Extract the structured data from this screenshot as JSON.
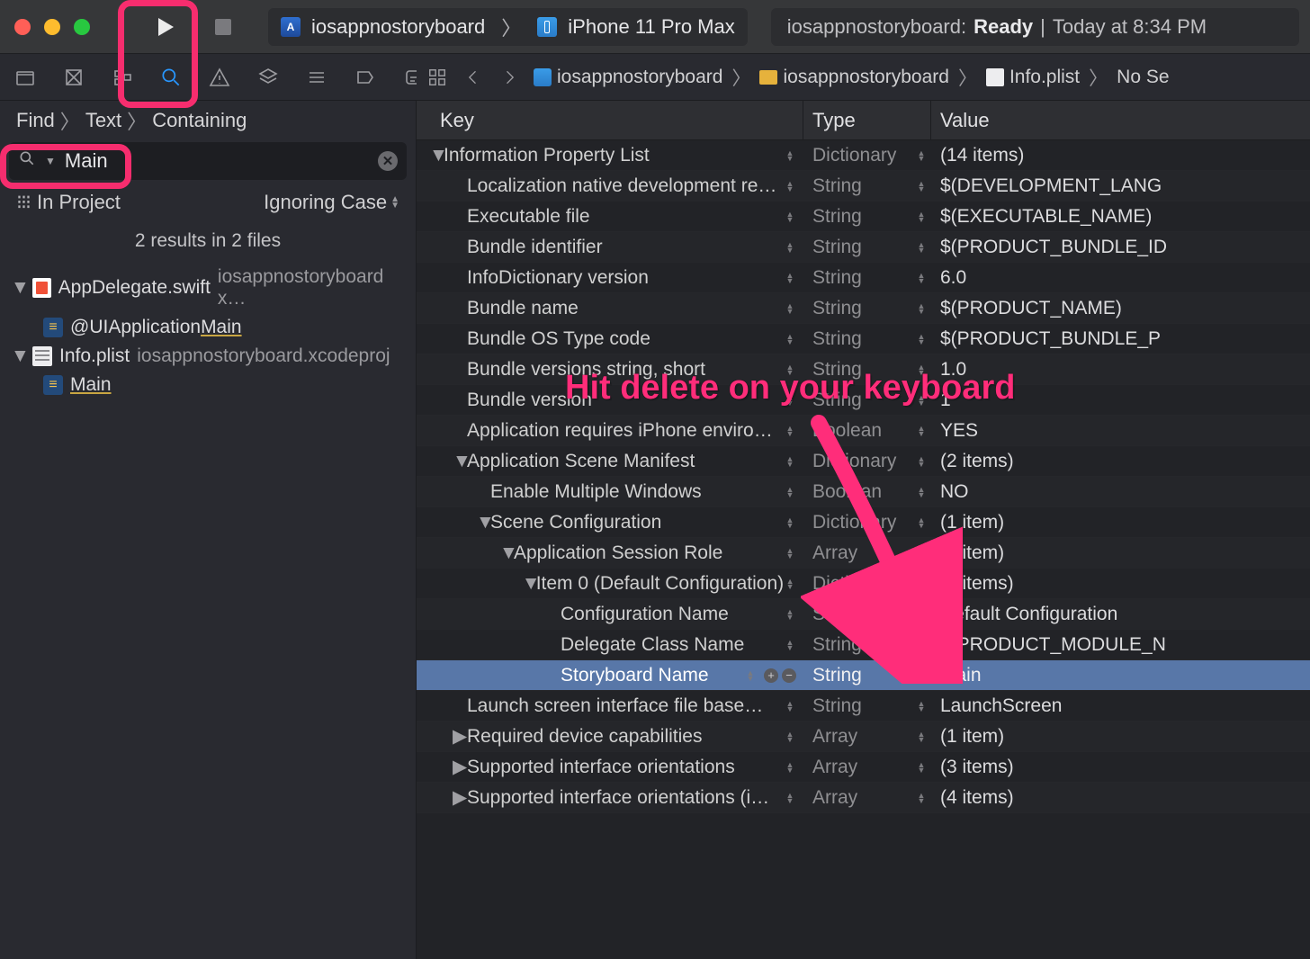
{
  "toolbar": {
    "scheme_app": "iosappnostoryboard",
    "scheme_device": "iPhone 11 Pro Max",
    "status_app": "iosappnostoryboard:",
    "status_state": "Ready",
    "status_sep": "|",
    "status_time": "Today at 8:34 PM"
  },
  "find": {
    "crumbs": [
      "Find",
      "Text",
      "Containing"
    ],
    "query": "Main",
    "scope_label": "In Project",
    "case_label": "Ignoring Case",
    "summary": "2 results in 2 files"
  },
  "results": [
    {
      "file": "AppDelegate.swift",
      "file_suffix": "iosappnostoryboard x…",
      "icon": "swift",
      "matches": [
        {
          "prefix": "@UIApplication",
          "hit": "Main",
          "suffix": ""
        }
      ]
    },
    {
      "file": "Info.plist",
      "file_suffix": "iosappnostoryboard.xcodeproj",
      "icon": "plist",
      "matches": [
        {
          "prefix": "",
          "hit": "Main",
          "suffix": ""
        }
      ]
    }
  ],
  "crumbs": {
    "items": [
      "iosappnostoryboard",
      "iosappnostoryboard",
      "Info.plist",
      "No Se"
    ]
  },
  "plist": {
    "headers": {
      "key": "Key",
      "type": "Type",
      "value": "Value"
    },
    "rows": [
      {
        "indent": 0,
        "disclosure": "▼",
        "key": "Information Property List",
        "type": "Dictionary",
        "value": "(14 items)",
        "alt": false
      },
      {
        "indent": 1,
        "disclosure": "",
        "key": "Localization native development re…",
        "type": "String",
        "value": "$(DEVELOPMENT_LANG",
        "alt": true
      },
      {
        "indent": 1,
        "disclosure": "",
        "key": "Executable file",
        "type": "String",
        "value": "$(EXECUTABLE_NAME)",
        "alt": false
      },
      {
        "indent": 1,
        "disclosure": "",
        "key": "Bundle identifier",
        "type": "String",
        "value": "$(PRODUCT_BUNDLE_ID",
        "alt": true
      },
      {
        "indent": 1,
        "disclosure": "",
        "key": "InfoDictionary version",
        "type": "String",
        "value": "6.0",
        "alt": false
      },
      {
        "indent": 1,
        "disclosure": "",
        "key": "Bundle name",
        "type": "String",
        "value": "$(PRODUCT_NAME)",
        "alt": true
      },
      {
        "indent": 1,
        "disclosure": "",
        "key": "Bundle OS Type code",
        "type": "String",
        "value": "$(PRODUCT_BUNDLE_P",
        "alt": false
      },
      {
        "indent": 1,
        "disclosure": "",
        "key": "Bundle versions string, short",
        "type": "String",
        "value": "1.0",
        "alt": true
      },
      {
        "indent": 1,
        "disclosure": "",
        "key": "Bundle version",
        "type": "String",
        "value": "1",
        "alt": false
      },
      {
        "indent": 1,
        "disclosure": "",
        "key": "Application requires iPhone enviro…",
        "type": "Boolean",
        "value": "YES",
        "alt": true
      },
      {
        "indent": 1,
        "disclosure": "▼",
        "key": "Application Scene Manifest",
        "type": "Dictionary",
        "value": "(2 items)",
        "alt": false
      },
      {
        "indent": 2,
        "disclosure": "",
        "key": "Enable Multiple Windows",
        "type": "Boolean",
        "value": "NO",
        "alt": true
      },
      {
        "indent": 2,
        "disclosure": "▼",
        "key": "Scene Configuration",
        "type": "Dictionary",
        "value": "(1 item)",
        "alt": false
      },
      {
        "indent": 3,
        "disclosure": "▼",
        "key": "Application Session Role",
        "type": "Array",
        "value": "(1 item)",
        "alt": true
      },
      {
        "indent": 4,
        "disclosure": "▼",
        "key": "Item 0 (Default Configuration)",
        "type": "Dictionary",
        "value": "(3 items)",
        "alt": false
      },
      {
        "indent": 5,
        "disclosure": "",
        "key": "Configuration Name",
        "type": "String",
        "value": "Default Configuration",
        "alt": true
      },
      {
        "indent": 5,
        "disclosure": "",
        "key": "Delegate Class Name",
        "type": "String",
        "value": "$(PRODUCT_MODULE_N",
        "alt": false
      },
      {
        "indent": 5,
        "disclosure": "",
        "key": "Storyboard Name",
        "type": "String",
        "value": "Main",
        "alt": true,
        "selected": true
      },
      {
        "indent": 1,
        "disclosure": "",
        "key": "Launch screen interface file base…",
        "type": "String",
        "value": "LaunchScreen",
        "alt": false
      },
      {
        "indent": 1,
        "disclosure": "▶",
        "key": "Required device capabilities",
        "type": "Array",
        "value": "(1 item)",
        "alt": true
      },
      {
        "indent": 1,
        "disclosure": "▶",
        "key": "Supported interface orientations",
        "type": "Array",
        "value": "(3 items)",
        "alt": false
      },
      {
        "indent": 1,
        "disclosure": "▶",
        "key": "Supported interface orientations (i…",
        "type": "Array",
        "value": "(4 items)",
        "alt": true
      }
    ]
  },
  "annotation": "Hit delete on your keyboard"
}
